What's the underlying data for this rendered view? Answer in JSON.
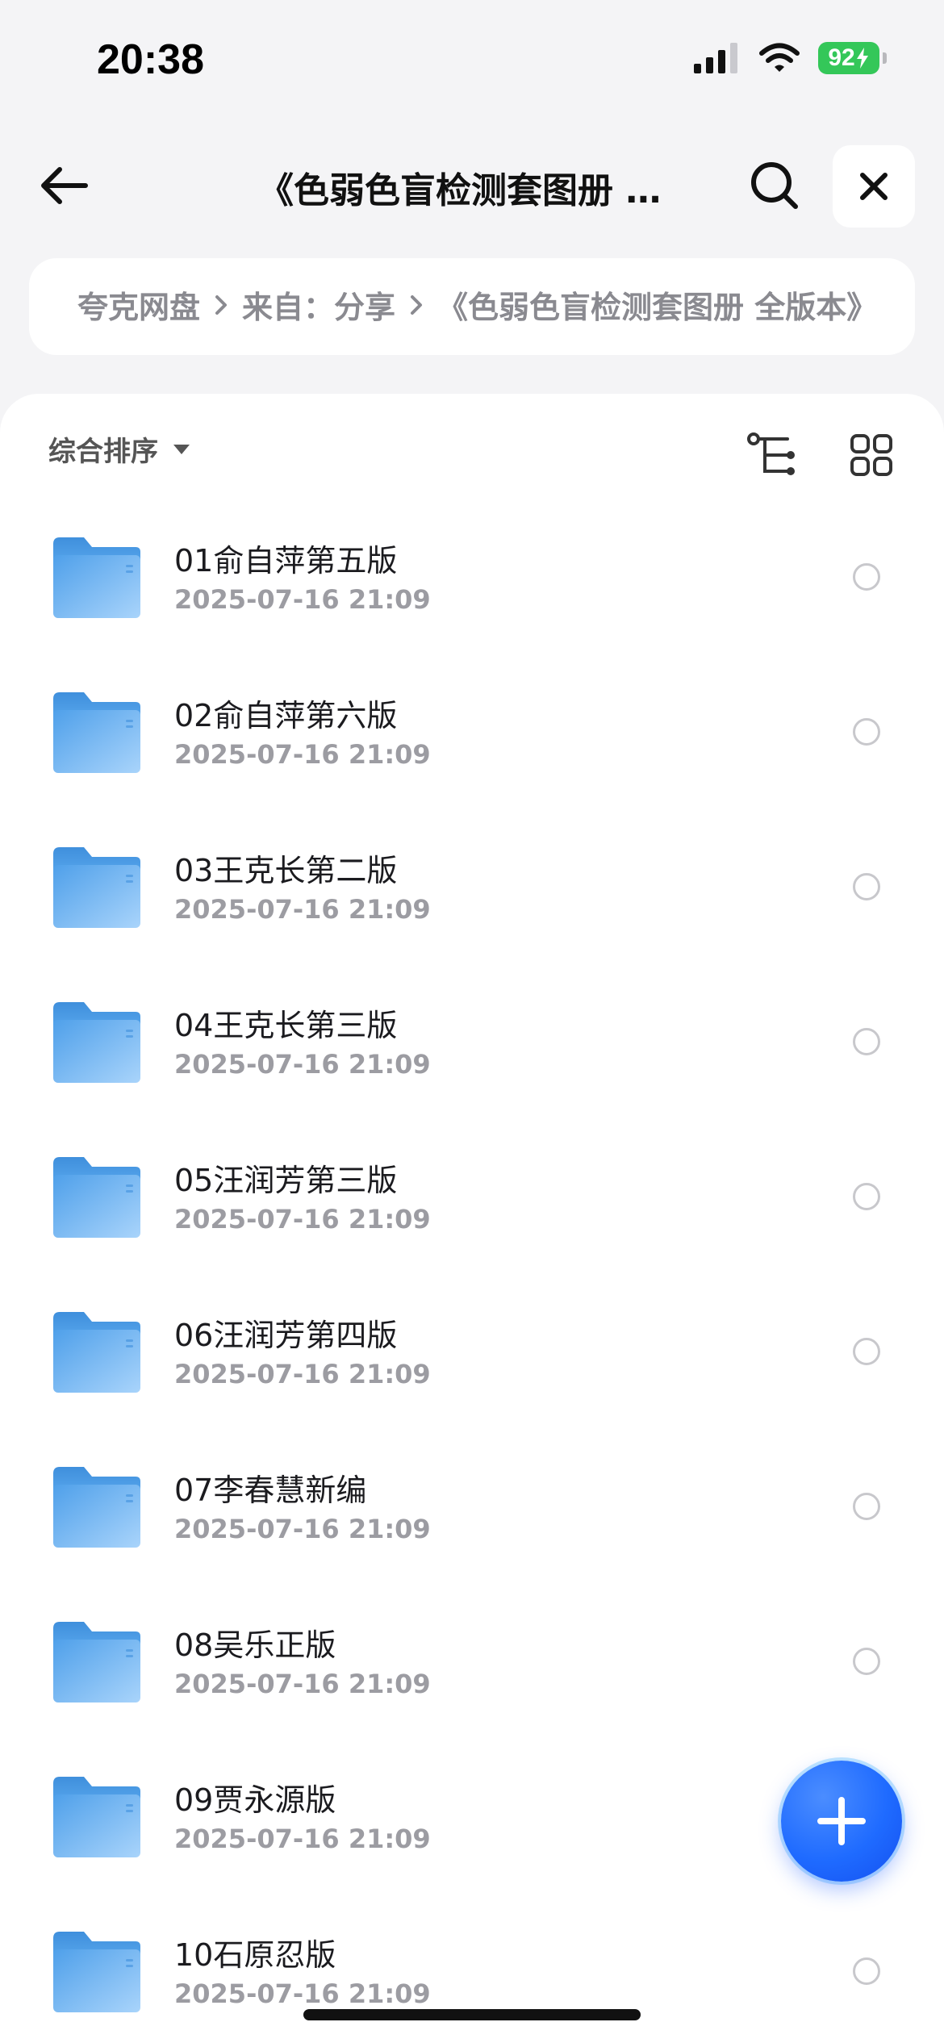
{
  "status_bar": {
    "time": "20:38",
    "battery": "92"
  },
  "nav": {
    "title": "《色弱色盲检测套图册 全版本》"
  },
  "breadcrumb": {
    "items": [
      "夸克网盘",
      "来自：分享",
      "《色弱色盲检测套图册 全版本》"
    ]
  },
  "toolbar": {
    "sort_label": "综合排序"
  },
  "files": [
    {
      "name": "01俞自萍第五版",
      "date": "2025-07-16 21:09"
    },
    {
      "name": "02俞自萍第六版",
      "date": "2025-07-16 21:09"
    },
    {
      "name": "03王克长第二版",
      "date": "2025-07-16 21:09"
    },
    {
      "name": "04王克长第三版",
      "date": "2025-07-16 21:09"
    },
    {
      "name": "05汪润芳第三版",
      "date": "2025-07-16 21:09"
    },
    {
      "name": "06汪润芳第四版",
      "date": "2025-07-16 21:09"
    },
    {
      "name": "07李春慧新编",
      "date": "2025-07-16 21:09"
    },
    {
      "name": "08吴乐正版",
      "date": "2025-07-16 21:09"
    },
    {
      "name": "09贾永源版",
      "date": "2025-07-16 21:09"
    },
    {
      "name": "10石原忍版",
      "date": "2025-07-16 21:09"
    }
  ],
  "icons": {
    "back": "arrow-left-icon",
    "search": "search-icon",
    "close": "close-icon",
    "sort": "caret-down-icon",
    "tree": "tree-view-icon",
    "grid": "grid-view-icon",
    "folder": "folder-icon",
    "add": "plus-icon"
  },
  "colors": {
    "accent": "#1f6bff",
    "folder": "#5aa9ee",
    "battery": "#34c759"
  }
}
